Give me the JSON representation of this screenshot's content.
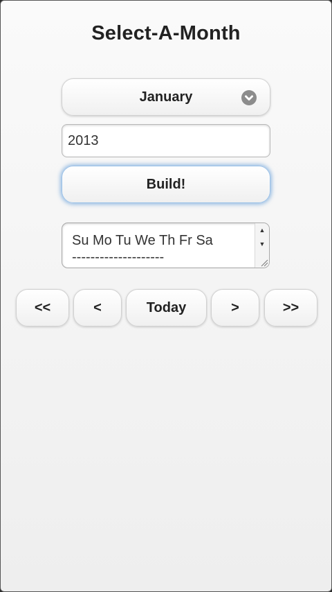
{
  "header": {
    "title": "Select-A-Month"
  },
  "month_select": {
    "selected": "January",
    "icon": "chevron-down-icon"
  },
  "year_input": {
    "value": "2013"
  },
  "build_button": {
    "label": "Build!"
  },
  "calendar_output": {
    "text": "Su Mo Tu We Th Fr Sa\n--------------------"
  },
  "nav": {
    "first_label": "<<",
    "prev_label": "<",
    "today_label": "Today",
    "next_label": ">",
    "last_label": ">>"
  },
  "colors": {
    "focus_glow": "#78aadc",
    "chevron_bg": "#8c8c8c"
  }
}
